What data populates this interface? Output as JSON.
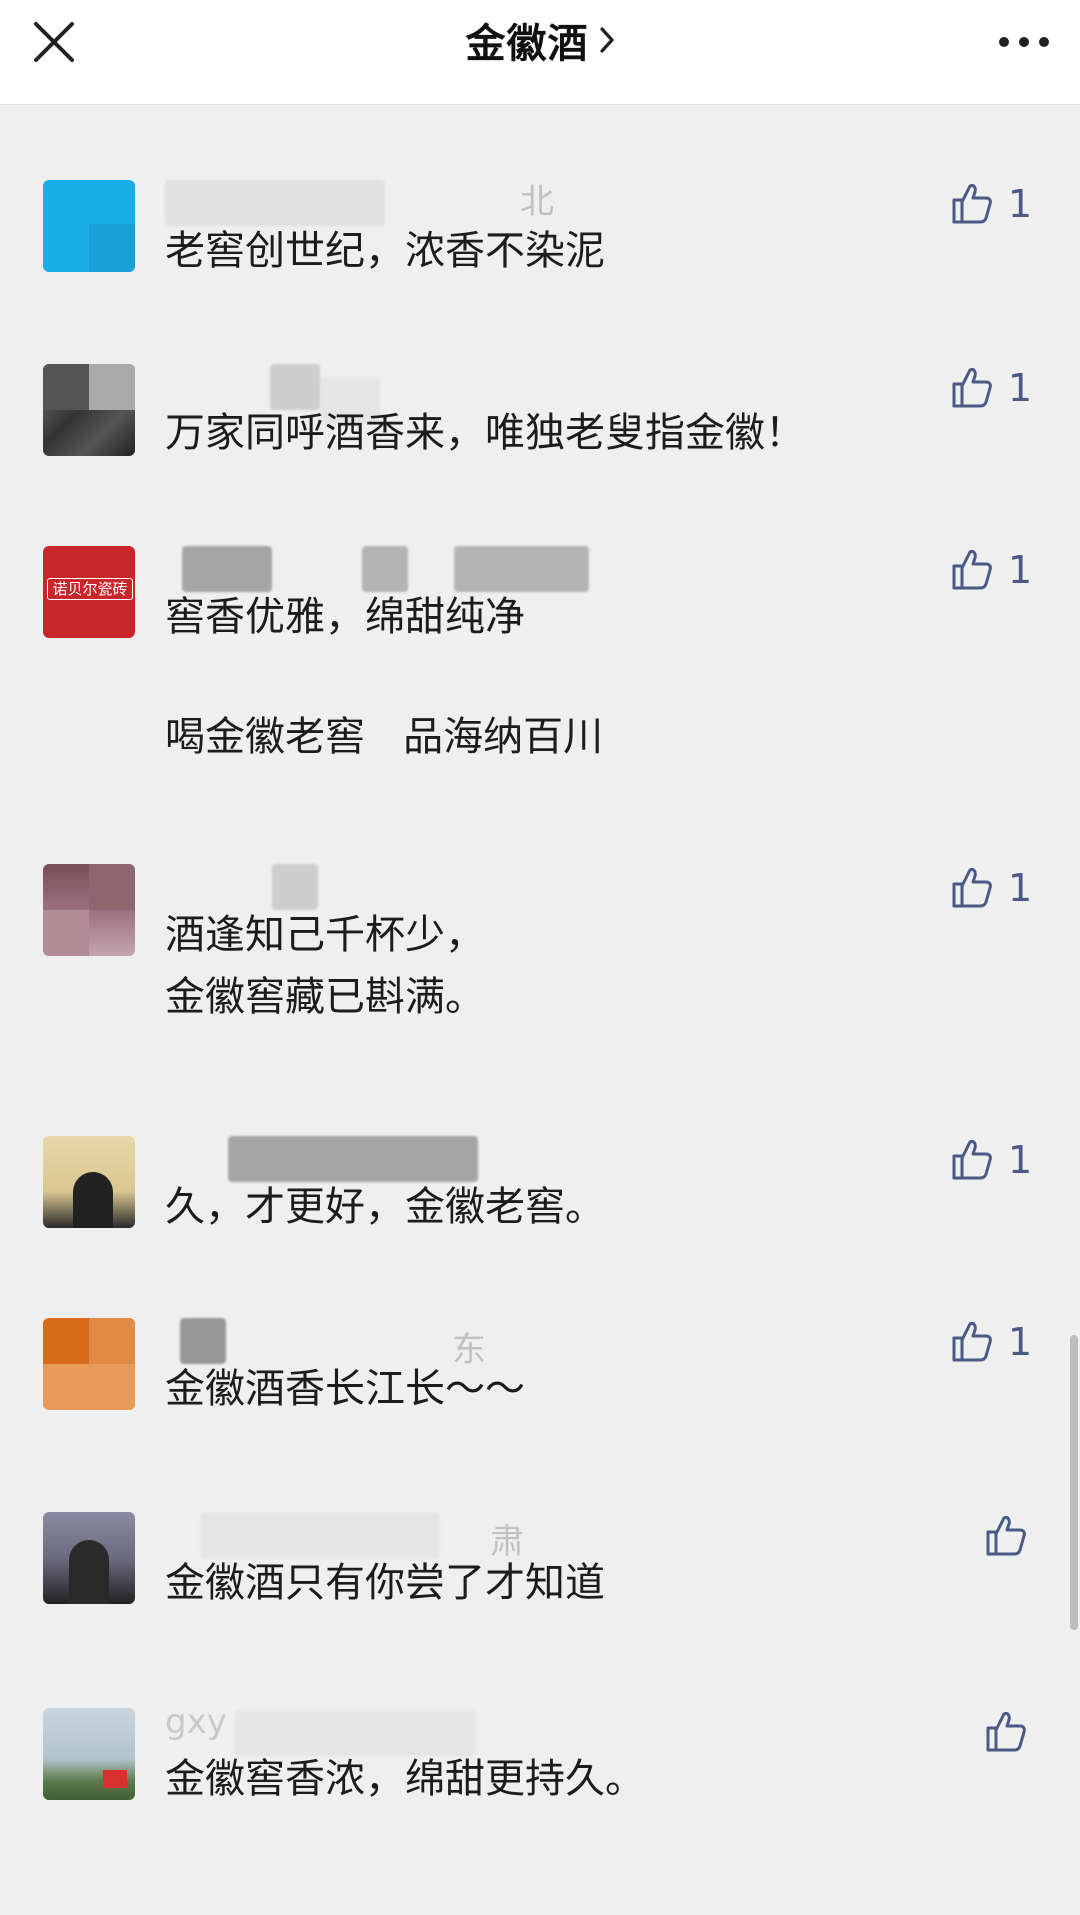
{
  "header": {
    "title": "金徽酒"
  },
  "comments": [
    {
      "name": "北",
      "text": "老窖创世纪，浓香不染泥",
      "likes": "1"
    },
    {
      "name": "",
      "text": "万家同呼酒香来，唯独老叟指金徽！",
      "likes": "1"
    },
    {
      "name": "",
      "text": "窖香优雅，绵甜纯净",
      "text2": "喝金徽老窖   品海纳百川",
      "likes": "1",
      "avatar_label": "诺贝尔瓷砖"
    },
    {
      "name": "",
      "text": "酒逢知己千杯少，\n金徽窖藏已斟满。",
      "likes": "1"
    },
    {
      "name": "",
      "text": "久，才更好，金徽老窖。",
      "likes": "1"
    },
    {
      "name": "东",
      "text": "金徽酒香长江长～～",
      "likes": "1"
    },
    {
      "name": "肃",
      "text": "金徽酒只有你尝了才知道",
      "likes": ""
    },
    {
      "name": "gxy",
      "text": "金徽窖香浓，绵甜更持久。",
      "likes": ""
    }
  ],
  "colors": {
    "background": "#efefef",
    "topbar": "#ffffff",
    "like": "#4a5a86"
  }
}
